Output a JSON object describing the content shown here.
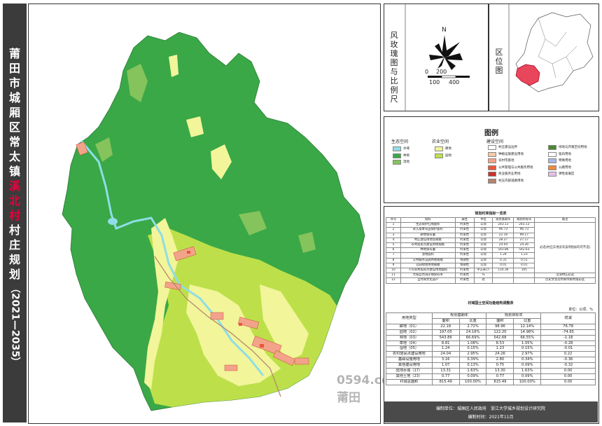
{
  "title": {
    "chars_top": [
      "莆",
      "田",
      "市",
      "城",
      "厢",
      "区",
      "常",
      "太",
      "镇"
    ],
    "chars_highlight": [
      "溪",
      "北",
      "村"
    ],
    "chars_bottom": [
      "村",
      "庄",
      "规",
      "划"
    ],
    "years": "（2021—2035）"
  },
  "rose_panel": {
    "label": "风玫瑰图与比例尺",
    "north": "N",
    "scale_ticks": [
      "0",
      "200",
      "100",
      "400"
    ]
  },
  "location_panel": {
    "label": "区位图"
  },
  "legend": {
    "title": "图例",
    "groups": [
      {
        "name": "生态空间",
        "items": [
          {
            "label": "水域",
            "color": "#8fdde6"
          },
          {
            "label": "林地",
            "color": "#3aa847"
          },
          {
            "label": "湿地",
            "color": "#85c35d"
          }
        ]
      },
      {
        "name": "农业空间",
        "items": [
          {
            "label": "耕地",
            "color": "#f2f59a"
          },
          {
            "label": "园地",
            "color": "#bde04a"
          }
        ]
      },
      {
        "name": "建设空间",
        "items": [
          {
            "label": "村庄建设边界",
            "color": "#ffffff"
          },
          {
            "label": "种植设施建设用地",
            "color": "#f3c9a8"
          },
          {
            "label": "农村宅基地",
            "color": "#f2a38a"
          },
          {
            "label": "公共管理与公共服务用地",
            "color": "#e8573a"
          },
          {
            "label": "商业服务业用地",
            "color": "#c9322a"
          },
          {
            "label": "村庄内部道路用地",
            "color": "#b4836e"
          }
        ]
      },
      {
        "name": "",
        "items": [
          {
            "label": "绿地与开敞空间用地",
            "color": "#4b8a2e"
          },
          {
            "label": "留白用地",
            "color": "#ffffff"
          },
          {
            "label": "特殊用地",
            "color": "#a8b8e8"
          },
          {
            "label": "公路用地",
            "color": "#f28a3a"
          },
          {
            "label": "弹性发展区",
            "color": "#e6c0e8"
          }
        ]
      }
    ]
  },
  "table1": {
    "caption": "规划约束指标一览表",
    "headers": [
      "序号",
      "指标",
      "属性",
      "单位",
      "现状基期年",
      "规划目标年",
      "备注"
    ],
    "rows": [
      [
        "1",
        "生态保护红线面积",
        "约束性",
        "公顷",
        "243.13",
        "243.13"
      ],
      [
        "2",
        "永久基本农田保护面积",
        "约束性",
        "公顷",
        "96.73",
        "96.73"
      ],
      [
        "3",
        "耕地保有量",
        "约束性",
        "公顷",
        "22.16",
        "99.17"
      ],
      [
        "4",
        "村庄建设用地总规模",
        "约束性",
        "公顷",
        "28.27",
        "27.17"
      ],
      [
        "5",
        "农村居民点建设用地规模",
        "约束性",
        "公顷",
        "24.04",
        "24.26"
      ],
      [
        "6",
        "林地保有量",
        "约束性",
        "公顷",
        "543.86",
        "542.63"
      ],
      [
        "7",
        "湿地面积",
        "约束性",
        "公顷",
        "1.24",
        "1.23"
      ],
      [
        "8",
        "公共服务设施用地规模",
        "预期性",
        "公顷",
        "0.31",
        "0.51"
      ],
      [
        "9",
        "公园绿地用地规模",
        "预期性",
        "公顷",
        "0.01",
        "0.01"
      ],
      [
        "10",
        "人均农村居民点建设用地面积",
        "约束性",
        "平方米/人",
        "116.36",
        "105"
      ],
      [
        "11",
        "大陆自然海岸线保有率",
        "约束性",
        "%",
        "",
        ""
      ],
      [
        "12",
        "自然和文化遗产",
        "约束性",
        "处",
        "",
        ""
      ]
    ],
    "note_merged": "必选(村庄实地没有该项指标的可不选)",
    "note_11": "沿海村庄必选",
    "note_12": "历史文化名村和传统村落必选"
  },
  "table2": {
    "caption": "村域国土空间功能结构调整表",
    "unit": "单位：公顷、%",
    "headers": [
      "用地类型",
      "规划基期年",
      "规划目标年",
      "增减"
    ],
    "subheaders": [
      "面积",
      "比重",
      "面积",
      "比重"
    ],
    "rows": [
      [
        "耕地（01）",
        "22.18",
        "2.72%",
        "98.96",
        "12.14%",
        "76.78"
      ],
      [
        "园地（02）",
        "197.05",
        "24.16%",
        "122.20",
        "14.98%",
        "-74.65"
      ],
      [
        "林地（03）",
        "543.86",
        "66.69%",
        "542.68",
        "66.55%",
        "-1.18"
      ],
      [
        "草地（04）",
        "8.81",
        "1.08%",
        "8.53",
        "1.05%",
        "-0.28"
      ],
      [
        "湿地（05）",
        "1.24",
        "0.15%",
        "1.23",
        "0.15%",
        "-0.01"
      ],
      [
        "农村居民点建设用地",
        "24.04",
        "2.95%",
        "24.26",
        "2.97%",
        "0.22"
      ],
      [
        "基础设施用地",
        "3.16",
        "0.39%",
        "2.80",
        "0.34%",
        "-0.36"
      ],
      [
        "其他建设用地",
        "1.07",
        "0.13%",
        "0.75",
        "0.09%",
        "-0.32"
      ],
      [
        "陆地水域（17）",
        "13.31",
        "1.63%",
        "13.30",
        "1.63%",
        "0.00"
      ],
      [
        "其他土地（23）",
        "0.77",
        "0.09%",
        "0.77",
        "0.09%",
        "0.00"
      ],
      [
        "村域总面积",
        "815.49",
        "100.00%",
        "815.49",
        "100.00%",
        "0.00"
      ]
    ]
  },
  "footer": {
    "line1": "编制单位：城厢区人民政府　浙江大学城乡规划设计研究院",
    "line2": "编制时间：2021年11月"
  },
  "watermark": "0594.com 莆田",
  "colors": {
    "forest": "#3aa847",
    "orchard": "#bde04a",
    "farmland": "#f2f59a",
    "wetland": "#85c35d",
    "water": "#8fdde6",
    "homestead": "#f2a38a",
    "public": "#e8573a",
    "road": "#b4836e",
    "highlight_title": "#e8003c"
  }
}
